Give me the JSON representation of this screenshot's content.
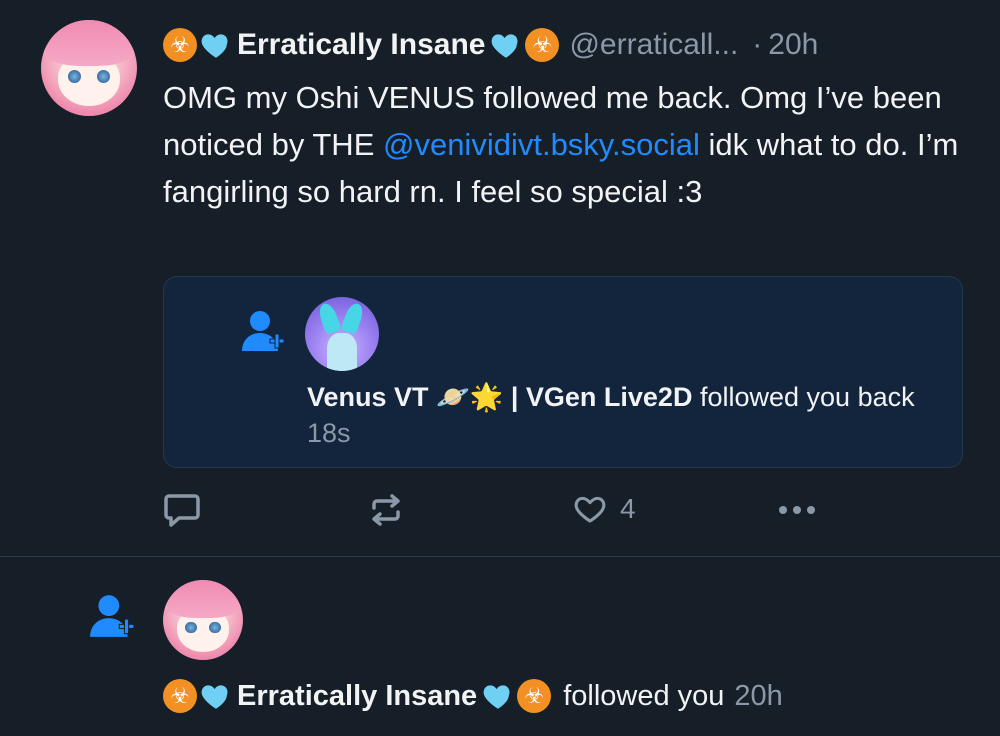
{
  "post": {
    "author": {
      "display_name": "Erratically Insane",
      "prefix_emoji": [
        "biohazard",
        "light-blue-heart"
      ],
      "suffix_emoji": [
        "light-blue-heart",
        "biohazard"
      ],
      "handle": "@erraticall...",
      "separator": "·",
      "time": "20h"
    },
    "text_parts": {
      "before_mention": "OMG my Oshi VENUS followed me back. Omg I’ve been noticed by THE ",
      "mention": "@venividivt.bsky.social",
      "after_mention": " idk what to do. I’m fangirling so hard rn. I feel so special :3"
    },
    "embed": {
      "name": "Venus VT",
      "emoji": [
        "ringed-planet",
        "glowing-star"
      ],
      "name_suffix": "| VGen Live2D",
      "action": "followed you back",
      "time": "18s"
    },
    "actions": {
      "reply_icon": "reply-icon",
      "repost_icon": "repost-icon",
      "like_icon": "heart-outline-icon",
      "like_count": "4",
      "more_icon": "ellipsis-icon"
    }
  },
  "notification": {
    "display_name": "Erratically Insane",
    "action": "followed you",
    "time": "20h",
    "icon": "person-plus-icon"
  },
  "colors": {
    "background": "#161e27",
    "accent": "#208bfe",
    "muted": "#8a98a8",
    "embed_bg": "#13253d"
  }
}
